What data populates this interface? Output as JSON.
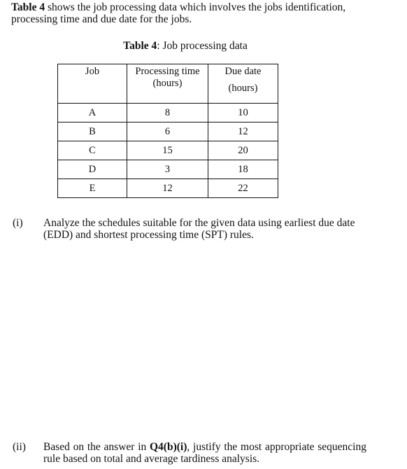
{
  "intro": {
    "bold_lead": "Table 4",
    "text": " shows the job processing data which involves the jobs identification, processing time and due date for the jobs."
  },
  "caption": {
    "bold_lead": "Table 4",
    "text": ": Job processing data"
  },
  "table": {
    "headers": {
      "job": "Job",
      "processing_time": "Processing time",
      "processing_time_unit": "(hours)",
      "due_date": "Due date",
      "due_date_unit": "(hours)"
    },
    "rows": [
      {
        "job": "A",
        "processing_time": "8",
        "due_date": "10"
      },
      {
        "job": "B",
        "processing_time": "6",
        "due_date": "12"
      },
      {
        "job": "C",
        "processing_time": "15",
        "due_date": "20"
      },
      {
        "job": "D",
        "processing_time": "3",
        "due_date": "18"
      },
      {
        "job": "E",
        "processing_time": "12",
        "due_date": "22"
      }
    ]
  },
  "questions": [
    {
      "number": "(i)",
      "text": "Analyze the schedules suitable for the given data using earliest due date (EDD) and shortest processing time (SPT) rules."
    },
    {
      "number": "(ii)",
      "text_before": "Based on the answer in ",
      "bold_ref": "Q4(b)(i)",
      "text_after": ", justify the most appropriate sequencing rule based on total and average tardiness analysis."
    }
  ]
}
